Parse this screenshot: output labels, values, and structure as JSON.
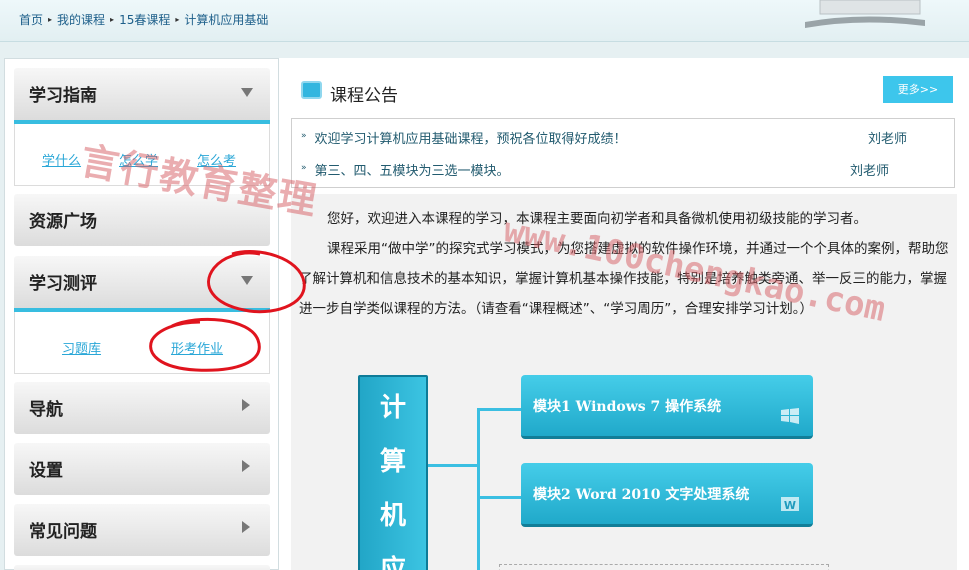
{
  "breadcrumb": {
    "items": [
      "首页",
      "我的课程",
      "15春课程",
      "计算机应用基础"
    ]
  },
  "sidebar": {
    "guide": {
      "title": "学习指南",
      "links": [
        "学什么",
        "怎么学",
        "怎么考"
      ]
    },
    "resources": {
      "title": "资源广场"
    },
    "assessment": {
      "title": "学习测评",
      "links": [
        "习题库",
        "形考作业"
      ]
    },
    "navigation": {
      "title": "导航"
    },
    "settings": {
      "title": "设置"
    },
    "faq": {
      "title": "常见问题"
    }
  },
  "main": {
    "notice_title": "课程公告",
    "more_label": "更多>>",
    "notices": [
      {
        "text": "欢迎学习计算机应用基础课程，预祝各位取得好成绩！",
        "author": "刘老师"
      },
      {
        "text": "第三、四、五模块为三选一模块。",
        "author": "刘老师"
      }
    ],
    "intro": [
      "您好，欢迎进入本课程的学习，本课程主要面向初学者和具备微机使用初级技能的学习者。",
      "课程采用“做中学”的探究式学习模式，为您搭建虚拟的软件操作环境，并通过一个个具体的案例，帮助您了解计算机和信息技术的基本知识，掌握计算机基本操作技能，特别是培养触类旁通、举一反三的能力，掌握进一步自学类似课程的方法。（请查看“课程概述”、“学习周历”，合理安排学习计划。）"
    ],
    "diagram": {
      "main_tile_chars": [
        "计",
        "算",
        "机",
        "应"
      ],
      "modules": [
        "模块1  Windows 7 操作系统",
        "模块2  Word 2010 文字处理系统"
      ]
    }
  },
  "watermark": {
    "cn": "言行教育整理",
    "url": "www.100chengkao.com"
  },
  "colors": {
    "accent": "#38bde0",
    "link": "#2aa7d7",
    "annotation": "#e0141e"
  }
}
